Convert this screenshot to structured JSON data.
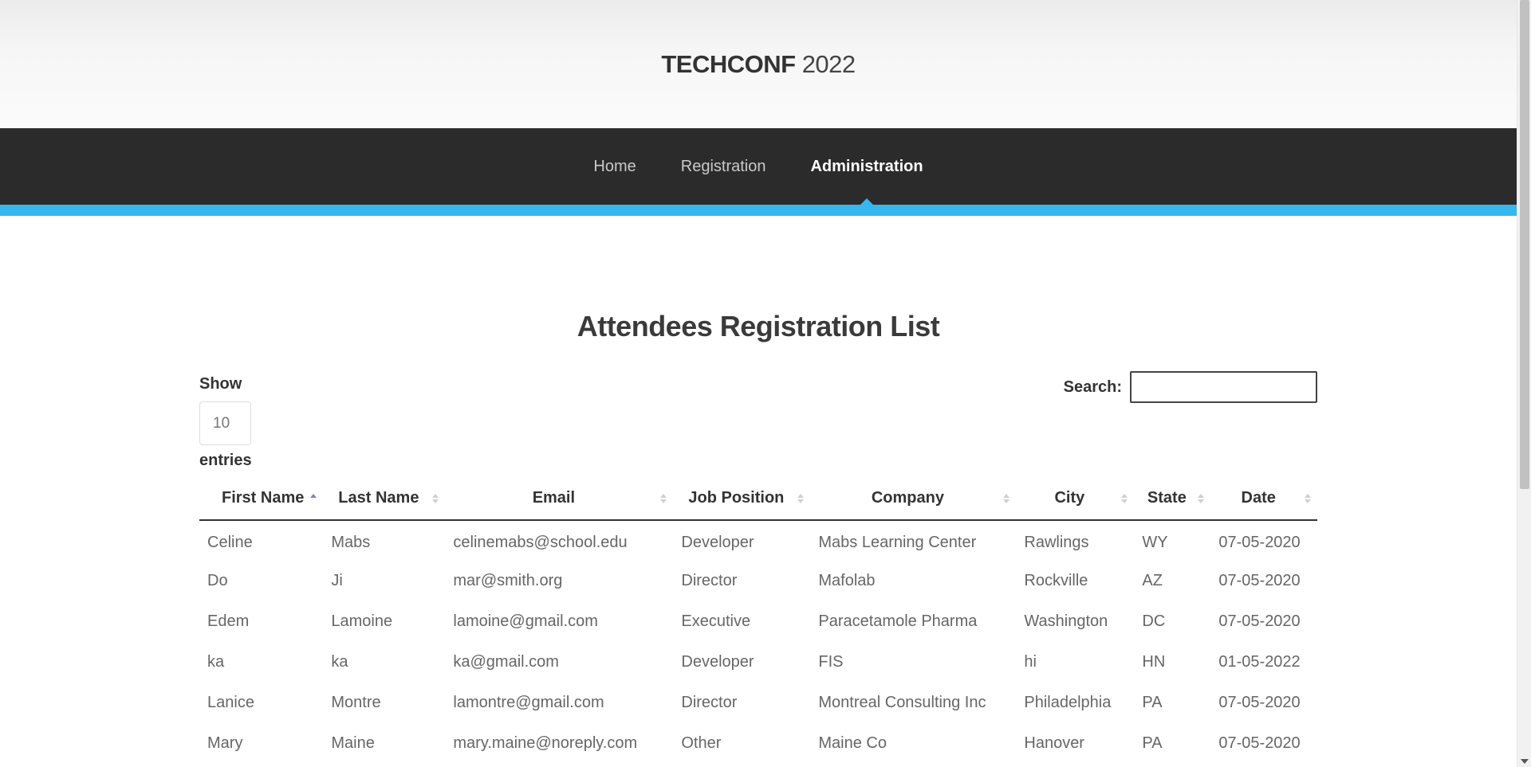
{
  "header": {
    "brand_name": "TECHCONF",
    "brand_year": "2022"
  },
  "nav": {
    "items": [
      {
        "label": "Home"
      },
      {
        "label": "Registration"
      },
      {
        "label": "Administration"
      }
    ],
    "active": "Administration"
  },
  "colors": {
    "accent": "#35b7ef",
    "nav_bg": "#2b2b2b",
    "sort_active": "#7b7fd4"
  },
  "main": {
    "title": "Attendees Registration List",
    "length": {
      "label_before": "Show",
      "value": "10",
      "label_after": "entries"
    },
    "search": {
      "label": "Search:",
      "value": ""
    },
    "table": {
      "columns": [
        "First Name",
        "Last Name",
        "Email",
        "Job Position",
        "Company",
        "City",
        "State",
        "Date"
      ],
      "sorted_column": "First Name",
      "sort_direction": "asc",
      "rows": [
        [
          "Celine",
          "Mabs",
          "celinemabs@school.edu",
          "Developer",
          "Mabs Learning Center",
          "Rawlings",
          "WY",
          "07-05-2020"
        ],
        [
          "Do",
          "Ji",
          "mar@smith.org",
          "Director",
          "Mafolab",
          "Rockville",
          "AZ",
          "07-05-2020"
        ],
        [
          "Edem",
          "Lamoine",
          "lamoine@gmail.com",
          "Executive",
          "Paracetamole Pharma",
          "Washington",
          "DC",
          "07-05-2020"
        ],
        [
          "ka",
          "ka",
          "ka@gmail.com",
          "Developer",
          "FIS",
          "hi",
          "HN",
          "01-05-2022"
        ],
        [
          "Lanice",
          "Montre",
          "lamontre@gmail.com",
          "Director",
          "Montreal Consulting Inc",
          "Philadelphia",
          "PA",
          "07-05-2020"
        ],
        [
          "Mary",
          "Maine",
          "mary.maine@noreply.com",
          "Other",
          "Maine Co",
          "Hanover",
          "PA",
          "07-05-2020"
        ]
      ]
    }
  }
}
